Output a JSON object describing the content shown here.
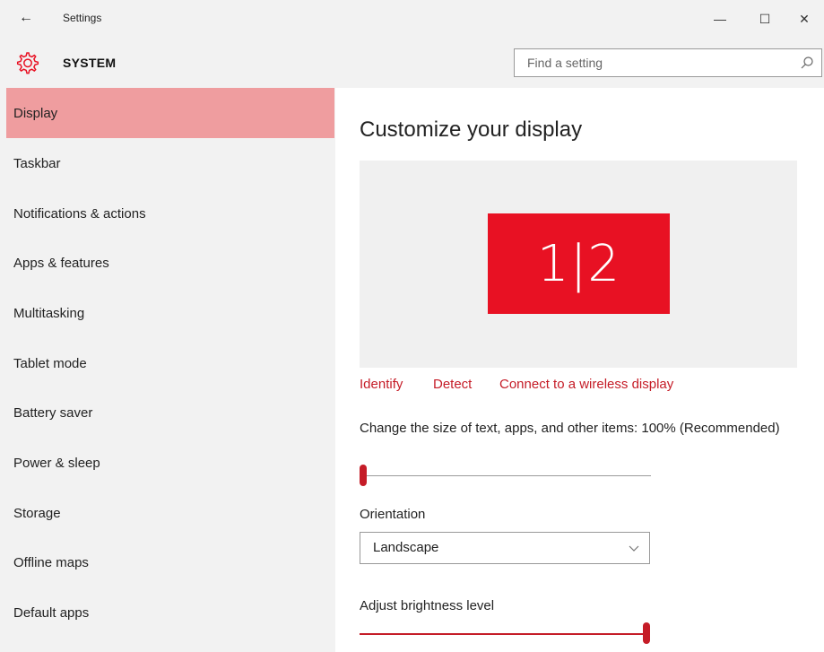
{
  "window": {
    "title": "Settings",
    "back_glyph": "←",
    "minimize_glyph": "—",
    "maximize_glyph": "☐",
    "close_glyph": "✕"
  },
  "header": {
    "icon": "gear-icon",
    "section": "SYSTEM",
    "search_placeholder": "Find a setting",
    "search_value": ""
  },
  "sidebar": {
    "items": [
      {
        "label": "Display",
        "active": true
      },
      {
        "label": "Taskbar",
        "active": false
      },
      {
        "label": "Notifications & actions",
        "active": false
      },
      {
        "label": "Apps & features",
        "active": false
      },
      {
        "label": "Multitasking",
        "active": false
      },
      {
        "label": "Tablet mode",
        "active": false
      },
      {
        "label": "Battery saver",
        "active": false
      },
      {
        "label": "Power & sleep",
        "active": false
      },
      {
        "label": "Storage",
        "active": false
      },
      {
        "label": "Offline maps",
        "active": false
      },
      {
        "label": "Default apps",
        "active": false
      }
    ]
  },
  "main": {
    "title": "Customize your display",
    "monitor_label": "1|2",
    "links": {
      "identify": "Identify",
      "detect": "Detect",
      "wireless": "Connect to a wireless display"
    },
    "size_label": "Change the size of text, apps, and other items: 100% (Recommended)",
    "size_slider_fraction": 0,
    "orientation_label": "Orientation",
    "orientation_value": "Landscape",
    "brightness_label": "Adjust brightness level",
    "brightness_fraction": 1
  },
  "colors": {
    "accent": "#e81123",
    "link": "#c51c27",
    "nav_active": "#ef9d9f",
    "chrome": "#f2f2f2"
  }
}
